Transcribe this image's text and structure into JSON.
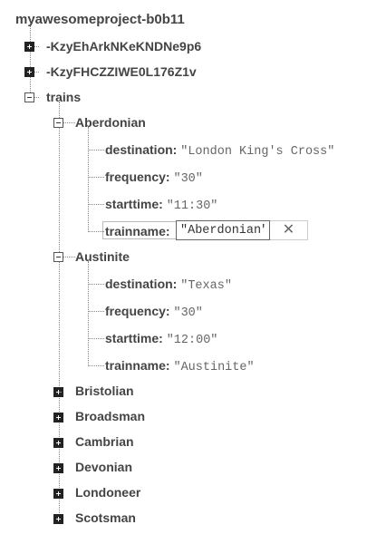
{
  "root": {
    "label": "myawesomeproject-b0b11"
  },
  "pushed": [
    {
      "label": "-KzyEhArkNKeKNDNe9p6"
    },
    {
      "label": "-KzyFHCZZIWE0L176Z1v"
    }
  ],
  "trains": {
    "label": "trains",
    "aberdonian": {
      "label": "Aberdonian",
      "destination_key": "destination:",
      "destination_val": "\"London King's Cross\"",
      "frequency_key": "frequency:",
      "frequency_val": "\"30\"",
      "starttime_key": "starttime:",
      "starttime_val": "\"11:30\"",
      "trainname_key": "trainname:",
      "trainname_val": "\"Aberdonian\"",
      "close_glyph": "✕"
    },
    "austinite": {
      "label": "Austinite",
      "destination_key": "destination:",
      "destination_val": "\"Texas\"",
      "frequency_key": "frequency:",
      "frequency_val": "\"30\"",
      "starttime_key": "starttime:",
      "starttime_val": "\"12:00\"",
      "trainname_key": "trainname:",
      "trainname_val": "\"Austinite\""
    },
    "collapsed": [
      {
        "label": "Bristolian"
      },
      {
        "label": "Broadsman"
      },
      {
        "label": "Cambrian"
      },
      {
        "label": "Devonian"
      },
      {
        "label": "Londoneer"
      },
      {
        "label": "Scotsman"
      }
    ]
  },
  "icons": {
    "expand": "plus-box-icon",
    "collapse": "minus-box-icon"
  }
}
